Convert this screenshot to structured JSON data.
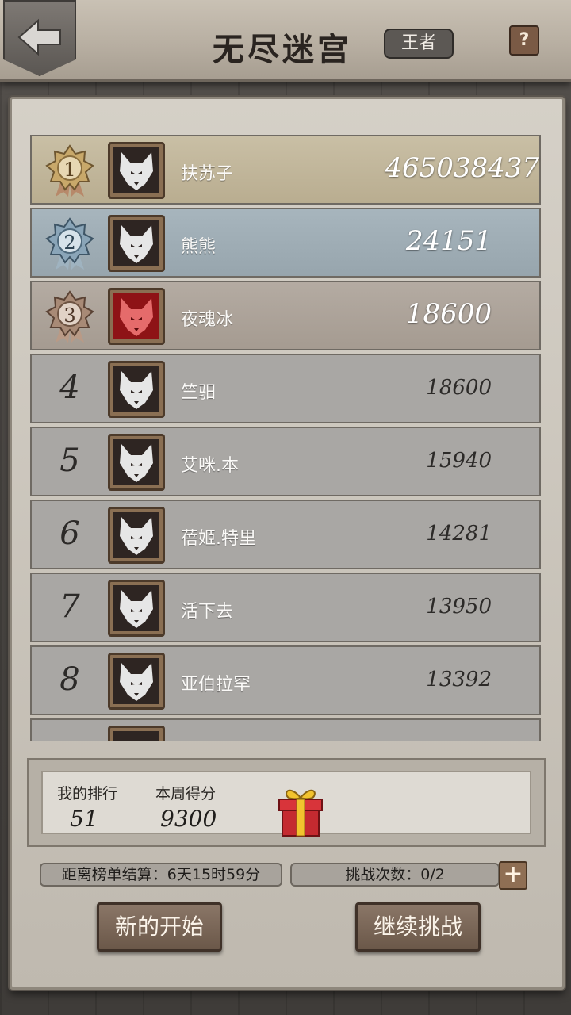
{
  "header": {
    "title": "无尽迷宫",
    "tier": "王者",
    "help": "?"
  },
  "leaderboard": [
    {
      "rank": "1",
      "name": "扶苏子",
      "score": "465038437"
    },
    {
      "rank": "2",
      "name": "熊熊",
      "score": "24151"
    },
    {
      "rank": "3",
      "name": "夜魂冰",
      "score": "18600"
    },
    {
      "rank": "4",
      "name": "竺驲",
      "score": "18600"
    },
    {
      "rank": "5",
      "name": "艾咪.本",
      "score": "15940"
    },
    {
      "rank": "6",
      "name": "蓓姬.特里",
      "score": "14281"
    },
    {
      "rank": "7",
      "name": "活下去",
      "score": "13950"
    },
    {
      "rank": "8",
      "name": "亚伯拉罕",
      "score": "13392"
    }
  ],
  "my_stats": {
    "rank_label": "我的排行",
    "rank_value": "51",
    "score_label": "本周得分",
    "score_value": "9300"
  },
  "countdown": "距离榜单结算：6天15时59分",
  "challenges": "挑战次数：0/2",
  "buttons": {
    "restart": "新的开始",
    "continue": "继续挑战"
  },
  "colors": {
    "gold": "#c9bfa5",
    "silver": "#a7b5bd",
    "bronze": "#b4aba2",
    "wolf_red": "#8e1316"
  }
}
